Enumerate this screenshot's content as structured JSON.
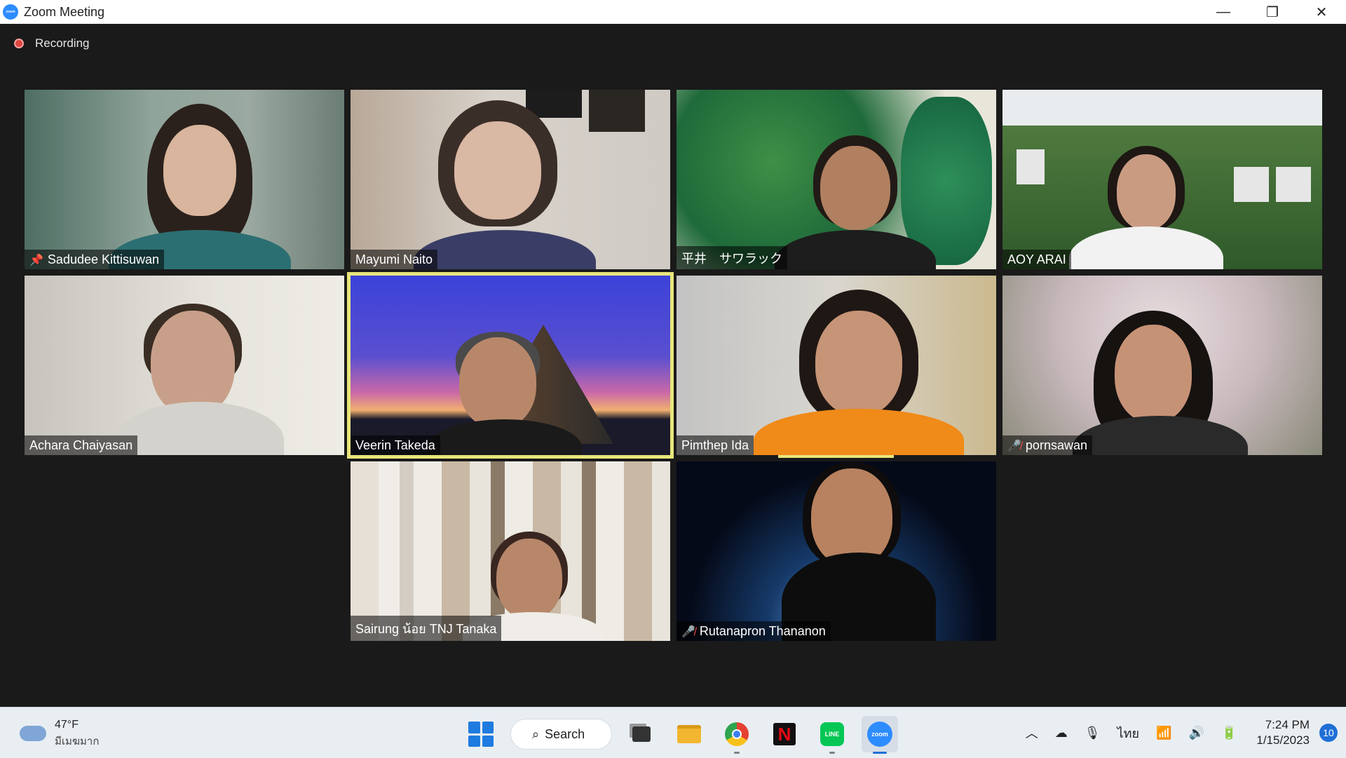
{
  "window": {
    "title": "Zoom Meeting",
    "minimize": "—",
    "restore": "❐",
    "close": "✕"
  },
  "recording": {
    "label": "Recording"
  },
  "participants": [
    {
      "name": "Sadudee Kittisuwan",
      "pinned": true,
      "muted": false
    },
    {
      "name": "Mayumi Naito",
      "pinned": false,
      "muted": false
    },
    {
      "name": "平井　サワラック",
      "pinned": false,
      "muted": false
    },
    {
      "name": "AOY ARAI",
      "pinned": false,
      "muted": false
    },
    {
      "name": "Achara Chaiyasan",
      "pinned": false,
      "muted": false
    },
    {
      "name": "Veerin Takeda",
      "pinned": false,
      "muted": false,
      "active_speaker": true
    },
    {
      "name": "Pimthep Ida",
      "pinned": false,
      "muted": false
    },
    {
      "name": "pornsawan",
      "pinned": false,
      "muted": true
    },
    {
      "name": "Sairung  น้อย TNJ Tanaka",
      "pinned": false,
      "muted": false
    },
    {
      "name": "Rutanapron Thananon",
      "pinned": false,
      "muted": true
    }
  ],
  "taskbar": {
    "weather_temp": "47°F",
    "weather_desc": "มีเมฆมาก",
    "search_label": "Search",
    "language": "ไทย",
    "time": "7:24 PM",
    "date": "1/15/2023",
    "notifications": "10",
    "zoom_label": "zoom",
    "line_label": "LINE",
    "netflix_label": "N"
  },
  "colors": {
    "accent": "#2d8cff",
    "active_speaker": "#e8e67a",
    "mute": "#ff4d4d"
  }
}
